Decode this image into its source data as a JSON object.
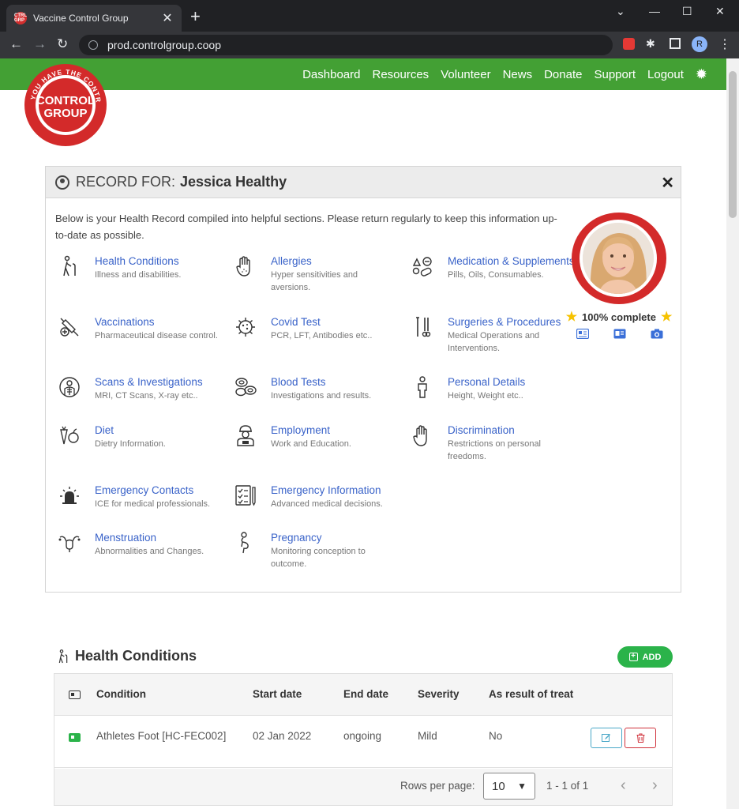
{
  "browser": {
    "tab_title": "Vaccine Control Group",
    "favicon_text": "CTRL GRP",
    "tab_close": "✕",
    "new_tab": "+",
    "url": "prod.controlgroup.coop",
    "profile_initial": "R",
    "win_minimize": "—",
    "win_maximize": "☐",
    "win_close": "✕",
    "tabs_dropdown": "⌄",
    "back": "←",
    "forward": "→",
    "reload": "↻",
    "menu": "⋮",
    "extensions_icon": "✱"
  },
  "nav": {
    "links": [
      "Dashboard",
      "Resources",
      "Volunteer",
      "News",
      "Donate",
      "Support",
      "Logout"
    ],
    "settings_icon": "gear-icon",
    "gear_glyph": "✹",
    "brand_color": "#43a034"
  },
  "logo": {
    "line1": "CONTROL",
    "line2": "GROUP",
    "tagline": "YOU HAVE THE CONTROL",
    "color": "#d32a2a"
  },
  "record": {
    "label": "RECORD FOR:",
    "name": "Jessica Healthy",
    "close": "✕",
    "intro": "Below is your Health Record compiled into helpful sections. Please return regularly to keep this information up-to-date as possible.",
    "sections": [
      {
        "title": "Health Conditions",
        "desc": "Illness and disabilities.",
        "icon": "person-cane-icon"
      },
      {
        "title": "Allergies",
        "desc": "Hyper sensitivities and aversions.",
        "icon": "hand-icon"
      },
      {
        "title": "Medication & Supplements",
        "desc": "Pills, Oils, Consumables.",
        "icon": "pills-icon"
      },
      {
        "title": "Vaccinations",
        "desc": "Pharmaceutical disease control.",
        "icon": "syringe-icon"
      },
      {
        "title": "Covid Test",
        "desc": "PCR, LFT, Antibodies etc..",
        "icon": "virus-icon"
      },
      {
        "title": "Surgeries & Procedures",
        "desc": "Medical Operations and Interventions.",
        "icon": "scalpel-icon"
      },
      {
        "title": "Scans & Investigations",
        "desc": "MRI, CT Scans, X-ray etc..",
        "icon": "xray-icon"
      },
      {
        "title": "Blood Tests",
        "desc": "Investigations and results.",
        "icon": "blood-cells-icon"
      },
      {
        "title": "Personal Details",
        "desc": "Height, Weight etc..",
        "icon": "person-icon"
      },
      {
        "title": "Diet",
        "desc": "Dietry Information.",
        "icon": "food-icon"
      },
      {
        "title": "Employment",
        "desc": "Work and Education.",
        "icon": "worker-icon"
      },
      {
        "title": "Discrimination",
        "desc": "Restrictions on personal freedoms.",
        "icon": "raised-hand-icon"
      },
      {
        "title": "Emergency Contacts",
        "desc": "ICE for medical professionals.",
        "icon": "siren-icon"
      },
      {
        "title": "Emergency Information",
        "desc": "Advanced medical decisions.",
        "icon": "checklist-icon"
      },
      {
        "title": "Menstruation",
        "desc": "Abnormalities and Changes.",
        "icon": "uterus-icon"
      },
      {
        "title": "Pregnancy",
        "desc": "Monitoring conception to outcome.",
        "icon": "pregnant-icon"
      }
    ],
    "completion": "100% complete",
    "profile_ring_color": "#d32a2a"
  },
  "conditions": {
    "title": "Health Conditions",
    "add_label": "ADD",
    "columns": [
      "Condition",
      "Start date",
      "End date",
      "Severity",
      "As result of treat"
    ],
    "rows": [
      {
        "condition": "Athletes Foot [HC-FEC002]",
        "start": "02 Jan 2022",
        "end": "ongoing",
        "severity": "Mild",
        "as_result": "No"
      }
    ],
    "rows_per_page_label": "Rows per page:",
    "rows_per_page": "10",
    "range": "1 - 1 of 1",
    "prev": "‹",
    "next": "›"
  }
}
